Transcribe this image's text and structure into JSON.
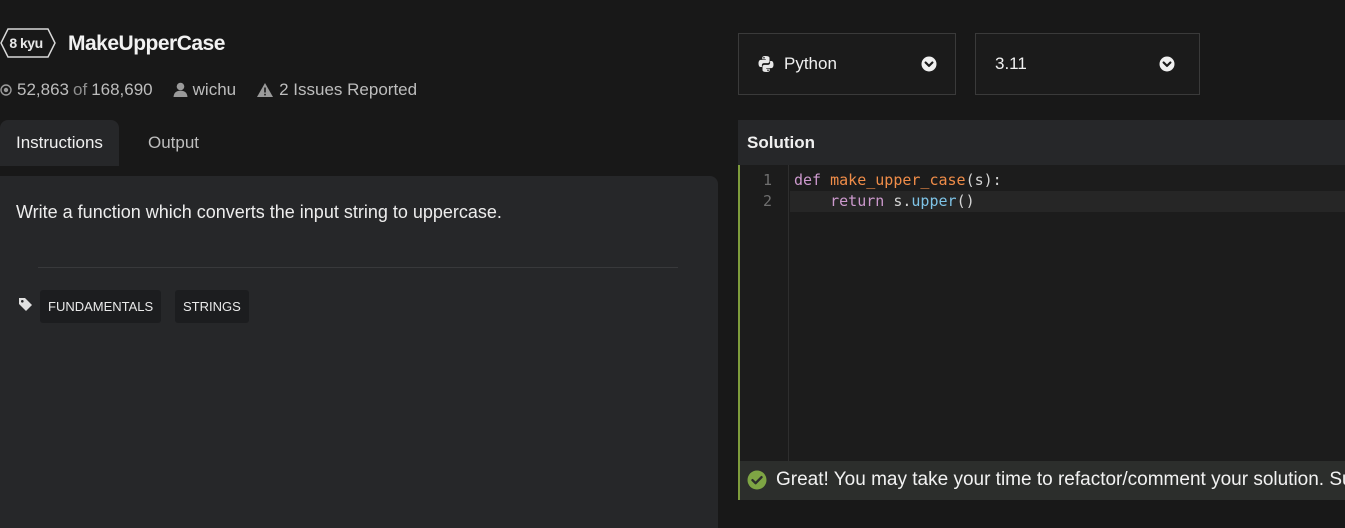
{
  "kata": {
    "rank": "8 kyu",
    "title": "MakeUpperCase",
    "completed": "52,863",
    "of_label": "of",
    "total": "168,690",
    "author": "wichu",
    "issues": "2 Issues Reported"
  },
  "tabs": [
    {
      "label": "Instructions",
      "active": true
    },
    {
      "label": "Output",
      "active": false
    }
  ],
  "description": "Write a function which converts the input string to uppercase.",
  "tags": [
    "FUNDAMENTALS",
    "STRINGS"
  ],
  "language_select": {
    "value": "Python",
    "icon": "python-icon"
  },
  "version_select": {
    "value": "3.11"
  },
  "solution": {
    "title": "Solution",
    "line_numbers": [
      "1",
      "2"
    ],
    "line1": {
      "kw": "def",
      "fn": "make_upper_case",
      "rest": "(s):"
    },
    "line2": {
      "kw": "return",
      "obj": "s.",
      "method": "upper",
      "rest": "()"
    }
  },
  "result_message": "Great! You may take your time to refactor/comment your solution. Sub",
  "colors": {
    "accent_green": "#7e9c3c",
    "background": "#181818",
    "panel": "#262729"
  }
}
